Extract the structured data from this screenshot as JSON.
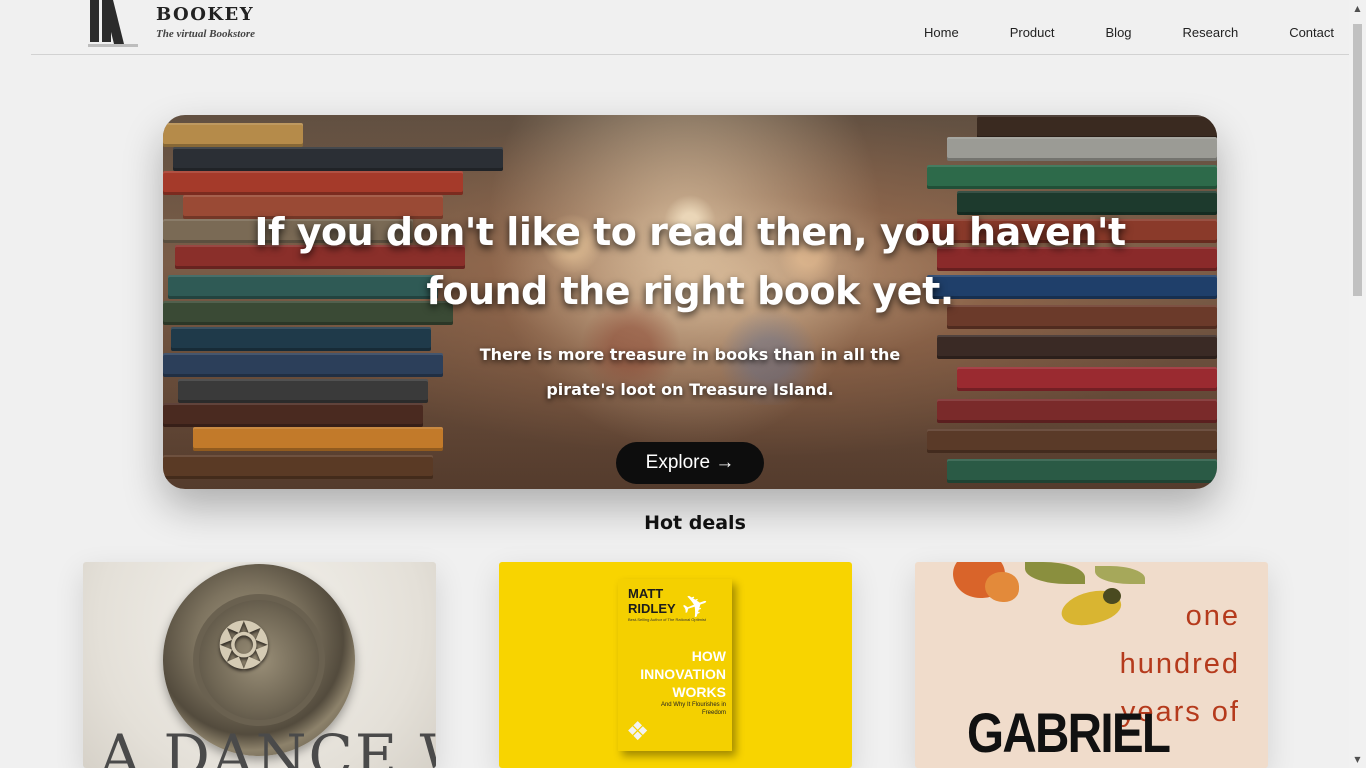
{
  "brand": {
    "name": "BOOKEY",
    "tagline": "The virtual Bookstore"
  },
  "nav": {
    "home": "Home",
    "product": "Product",
    "blog": "Blog",
    "research": "Research",
    "contact": "Contact"
  },
  "hero": {
    "title": "If you don't like to read then, you haven't found the right book yet.",
    "subtitle": "There is more treasure in books than in all the pirate's loot on Treasure Island.",
    "cta": "Explore →"
  },
  "hot_deals": {
    "title": "Hot deals",
    "cards": [
      {
        "cover_text": "A DANCE WITH"
      },
      {
        "author": "MATT RIDLEY",
        "title": "HOW INNOVATION WORKS",
        "subtitle": "And Why It Flourishes in Freedom",
        "author_tag": "Best-Selling Author of The Rational Optimist"
      },
      {
        "title": "one hundred years of",
        "author": "GABRIEL"
      }
    ]
  },
  "icons": {
    "logo": "books-logo-icon",
    "arrow": "arrow-right-icon",
    "scroll_up": "scroll-up-icon",
    "scroll_down": "scroll-down-icon"
  },
  "colors": {
    "page_bg": "#f0f0f0",
    "button_bg": "#0d0d0d",
    "card2_bg": "#f8d400",
    "card3_bg": "#f0dccb",
    "card3_text": "#b53a1c"
  }
}
